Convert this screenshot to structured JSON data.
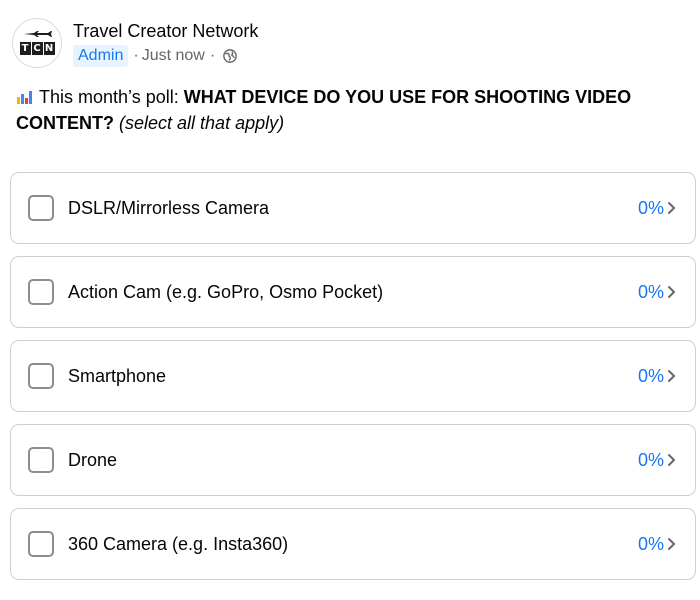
{
  "post": {
    "group_name": "Travel Creator Network",
    "avatar_letters": [
      "T",
      "C",
      "N"
    ],
    "role_badge": "Admin",
    "separator": "·",
    "timestamp": "Just now",
    "separator2": "·",
    "audience_icon": "globe-icon"
  },
  "poll": {
    "emoji_icon": "bar-chart-icon",
    "intro": "This month’s poll: ",
    "question": "WHAT DEVICE DO YOU USE FOR SHOOTING VIDEO CONTENT?",
    "instruction": "(select all that apply)",
    "options": [
      {
        "label": "DSLR/Mirrorless Camera",
        "percent": "0%"
      },
      {
        "label": "Action Cam (e.g. GoPro, Osmo Pocket)",
        "percent": "0%"
      },
      {
        "label": "Smartphone",
        "percent": "0%"
      },
      {
        "label": "Drone",
        "percent": "0%"
      },
      {
        "label": "360 Camera (e.g. Insta360)",
        "percent": "0%"
      }
    ]
  },
  "colors": {
    "accent": "#1877f2",
    "admin_badge_bg": "#e7f3ff",
    "border": "#ced0d4",
    "checkbox_border": "#8a8d91",
    "text": "#050505",
    "secondary_text": "#65676b"
  }
}
